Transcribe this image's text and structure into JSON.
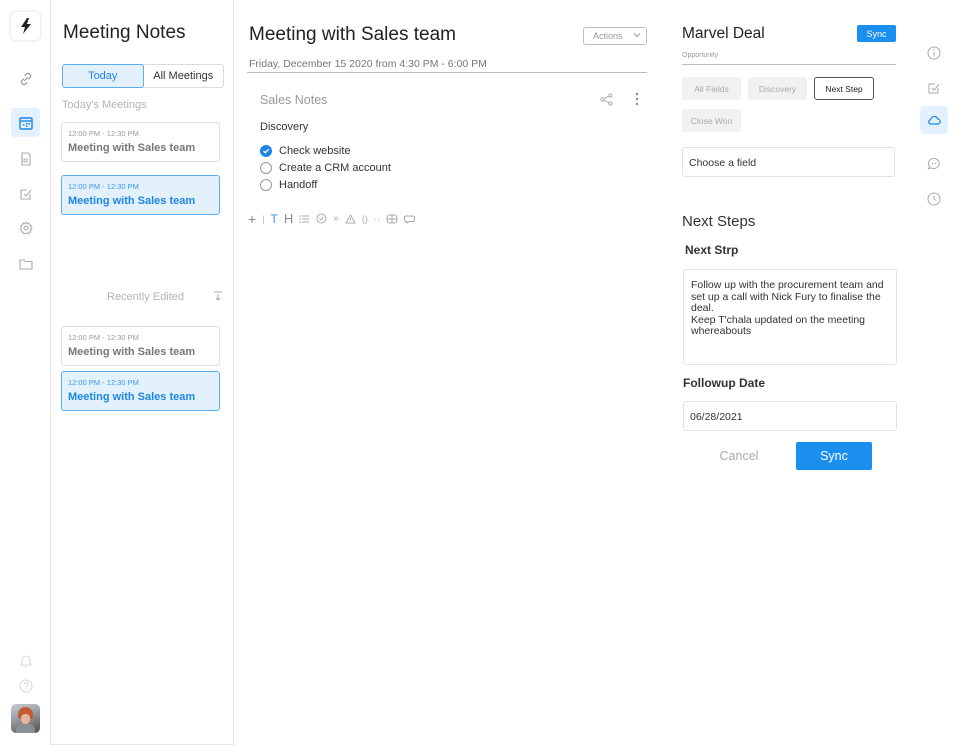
{
  "app": {
    "name": "Meeting Notes",
    "brand_color": "#1a8ff0",
    "accent_light": "#e3f1fd"
  },
  "left_rail": {
    "logo_icon": "lightning-icon",
    "items": [
      {
        "icon": "link-icon",
        "active": false
      },
      {
        "icon": "calendar-icon",
        "active": true
      },
      {
        "icon": "document-icon",
        "active": false
      },
      {
        "icon": "checkbox-icon",
        "active": false
      },
      {
        "icon": "gear-icon",
        "active": false
      },
      {
        "icon": "folder-icon",
        "active": false
      }
    ],
    "bottom": [
      {
        "icon": "bell-icon"
      },
      {
        "icon": "help-icon"
      },
      {
        "icon": "avatar"
      }
    ]
  },
  "notes_panel": {
    "title": "Meeting Notes",
    "tabs": [
      {
        "label": "Today",
        "active": true
      },
      {
        "label": "All Meetings",
        "active": false
      }
    ],
    "todays_label": "Today's Meetings",
    "todays_meetings": [
      {
        "time": "12:00 PM - 12:30 PM",
        "title": "Meeting with Sales team",
        "active": false
      },
      {
        "time": "12:00 PM - 12:30 PM",
        "title": "Meeting with Sales team",
        "active": true
      }
    ],
    "recent_label": "Recently Edited",
    "recent_meetings": [
      {
        "time": "12:00 PM - 12:30 PM",
        "title": "Meeting with Sales team",
        "active": false
      },
      {
        "time": "12:00 PM - 12:30 PM",
        "title": "Meeting with Sales team",
        "active": true
      }
    ]
  },
  "editor": {
    "title": "Meeting with Sales team",
    "actions_label": "Actions",
    "date": "Friday, December 15 2020 from 4:30 PM - 6:00 PM",
    "notes_title": "Sales Notes",
    "section": "Discovery",
    "todos": [
      {
        "label": "Check website",
        "done": true
      },
      {
        "label": "Create a CRM account",
        "done": false
      },
      {
        "label": "Handoff",
        "done": false
      }
    ],
    "toolbar": [
      "+",
      "|",
      "T",
      "H",
      "list",
      "check",
      "quote",
      "warning",
      "code",
      "divider",
      "table",
      "comment"
    ]
  },
  "deal": {
    "title": "Marvel Deal",
    "sync_label": "Sync",
    "subtitle": "Opportunity",
    "stages": [
      {
        "label": "All Fields",
        "active": false
      },
      {
        "label": "Discovery",
        "active": false
      },
      {
        "label": "Next Step",
        "active": true
      },
      {
        "label": "Close Won",
        "active": false
      }
    ],
    "field_select": "Choose a field",
    "section_title": "Next Steps",
    "next_step_label": "Next Strp",
    "next_step_text": "Follow up with the procurement team and set up a call with Nick Fury to finalise the deal.\nKeep T'chala updated on the meeting whereabouts",
    "followup_label": "Followup Date",
    "followup_value": "06/28/2021",
    "cancel_label": "Cancel",
    "sync_button_label": "Sync"
  },
  "right_rail": {
    "items": [
      {
        "icon": "info-icon",
        "active": false
      },
      {
        "icon": "checkbox-icon",
        "active": false
      },
      {
        "icon": "cloud-icon",
        "active": true
      },
      {
        "icon": "chat-icon",
        "active": false
      },
      {
        "icon": "clock-icon",
        "active": false
      }
    ]
  }
}
